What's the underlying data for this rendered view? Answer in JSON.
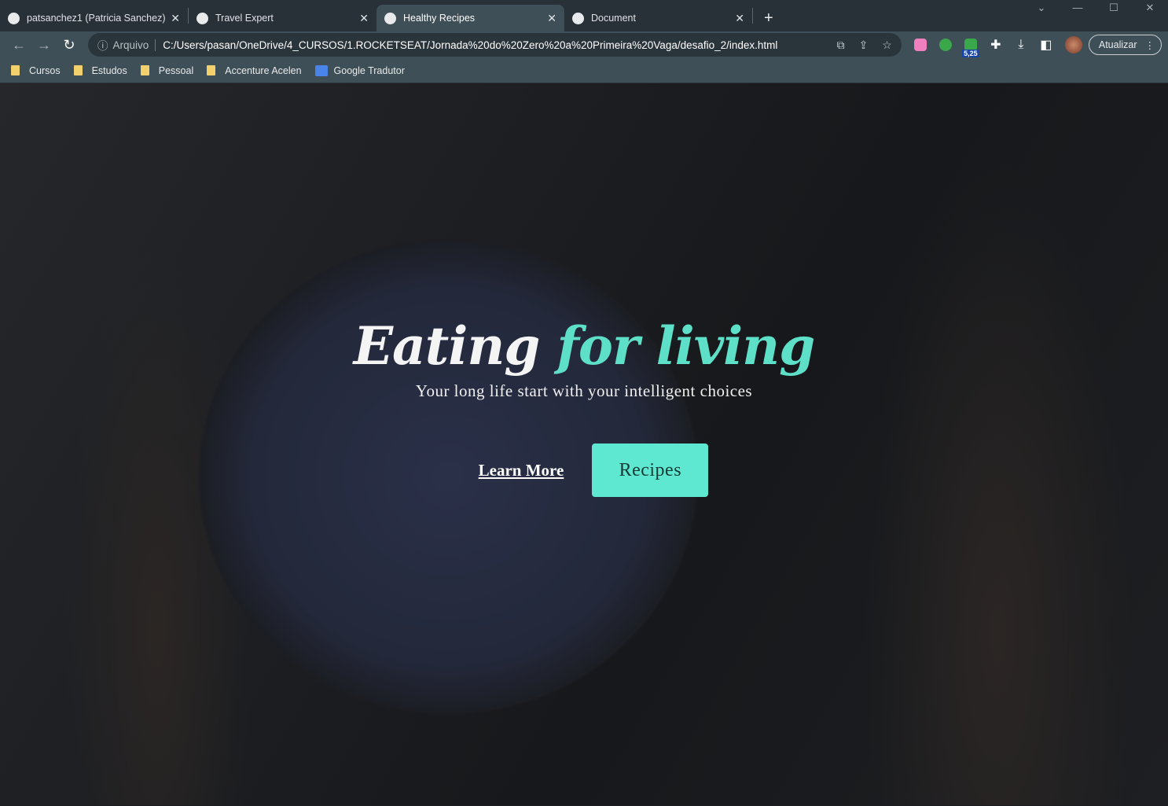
{
  "tabs": [
    {
      "label": "patsanchez1 (Patricia Sanchez)",
      "icon": "github-icon"
    },
    {
      "label": "Travel Expert",
      "icon": "globe-icon"
    },
    {
      "label": "Healthy Recipes",
      "icon": "globe-icon",
      "active": true
    },
    {
      "label": "Document",
      "icon": "globe-icon"
    }
  ],
  "toolbar": {
    "security_label": "Arquivo",
    "url": "C:/Users/pasan/OneDrive/4_CURSOS/1.ROCKETSEAT/Jornada%20do%20Zero%20a%20Primeira%20Vaga/desafio_2/index.html",
    "update_label": "Atualizar",
    "extension_badge": "5,25"
  },
  "bookmarks": [
    "Cursos",
    "Estudos",
    "Pessoal",
    "Accenture Acelen",
    "Google Tradutor"
  ],
  "hero": {
    "title_white": "Eating",
    "title_green": "for living",
    "subtitle": "Your long life start with your intelligent choices",
    "learn_more": "Learn More",
    "recipes": "Recipes"
  },
  "colors": {
    "accent": "#5ee8d2",
    "tab_bg": "#283137",
    "toolbar_bg": "#3f4f57"
  }
}
